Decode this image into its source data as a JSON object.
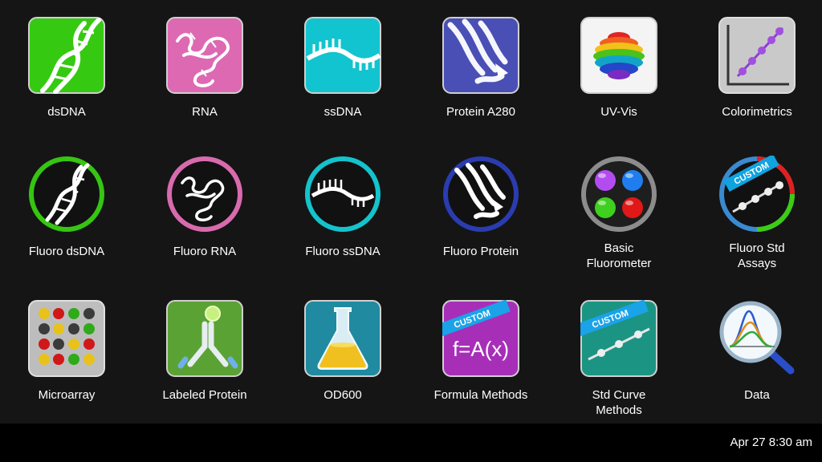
{
  "apps": [
    {
      "id": "dsdna",
      "label": "dsDNA",
      "icon": "dna-icon"
    },
    {
      "id": "rna",
      "label": "RNA",
      "icon": "rna-icon"
    },
    {
      "id": "ssdna",
      "label": "ssDNA",
      "icon": "ssdna-icon"
    },
    {
      "id": "protein-a280",
      "label": "Protein A280",
      "icon": "protein-icon"
    },
    {
      "id": "uv-vis",
      "label": "UV-Vis",
      "icon": "rainbow-sphere-icon"
    },
    {
      "id": "colorimetrics",
      "label": "Colorimetrics",
      "icon": "line-plot-icon"
    },
    {
      "id": "fluoro-dsdna",
      "label": "Fluoro dsDNA",
      "icon": "dna-ring-icon"
    },
    {
      "id": "fluoro-rna",
      "label": "Fluoro RNA",
      "icon": "rna-ring-icon"
    },
    {
      "id": "fluoro-ssdna",
      "label": "Fluoro ssDNA",
      "icon": "ssdna-ring-icon"
    },
    {
      "id": "fluoro-protein",
      "label": "Fluoro Protein",
      "icon": "protein-ring-icon"
    },
    {
      "id": "basic-fluorometer",
      "label_line1": "Basic",
      "label_line2": "Fluorometer",
      "icon": "four-dots-icon"
    },
    {
      "id": "fluoro-std-assays",
      "label_line1": "Fluoro Std",
      "label_line2": "Assays",
      "icon": "custom-curve-ring-icon",
      "ribbon": "CUSTOM"
    },
    {
      "id": "microarray",
      "label": "Microarray",
      "icon": "microarray-icon"
    },
    {
      "id": "labeled-protein",
      "label": "Labeled Protein",
      "icon": "antibody-icon"
    },
    {
      "id": "od600",
      "label": "OD600",
      "icon": "flask-icon"
    },
    {
      "id": "formula-methods",
      "label": "Formula Methods",
      "icon": "formula-icon",
      "ribbon": "CUSTOM",
      "formula": "f=A(x)"
    },
    {
      "id": "std-curve-methods",
      "label_line1": "Std Curve",
      "label_line2": "Methods",
      "icon": "std-curve-icon",
      "ribbon": "CUSTOM"
    },
    {
      "id": "data",
      "label": "Data",
      "icon": "magnifier-chart-icon"
    }
  ],
  "status": {
    "clock": "Apr 27 8:30 am"
  },
  "colors": {
    "background": "#151515",
    "statusbar": "#000000",
    "dsdna": "#33cc11",
    "rna": "#dd66b0",
    "ssdna": "#11c4cf",
    "protein": "#4a4fb6",
    "ribbon": "#1aa3e8"
  }
}
